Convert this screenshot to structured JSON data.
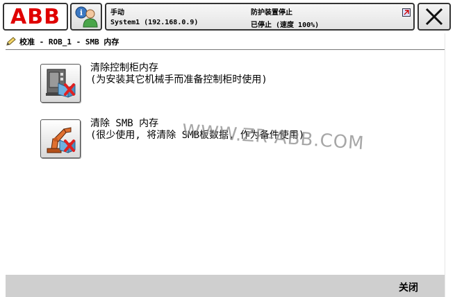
{
  "header": {
    "logo": "ABB",
    "mode": "手动",
    "system": "System1 (192.168.0.9)",
    "guard_status": "防护装置停止",
    "run_status": "已停止 (速度 100%)",
    "close_icon": "close-x-icon",
    "user_icon": "info-user-icon"
  },
  "breadcrumb": {
    "icon": "pencil-icon",
    "text": "校准 - ROB_1 - SMB 内存"
  },
  "menu": [
    {
      "icon": "controller-cabinet-clear-icon",
      "title": "清除控制柜内存",
      "subtitle": "(为安装其它机械手而准备控制柜时使用)"
    },
    {
      "icon": "robot-smb-clear-icon",
      "title": "清除 SMB 内存",
      "subtitle": "(很少使用, 将清除 SMB板数据, 作为备件使用)"
    }
  ],
  "watermark": "WWW.ZR-ABB.COM",
  "footer": {
    "close_label": "关闭"
  }
}
